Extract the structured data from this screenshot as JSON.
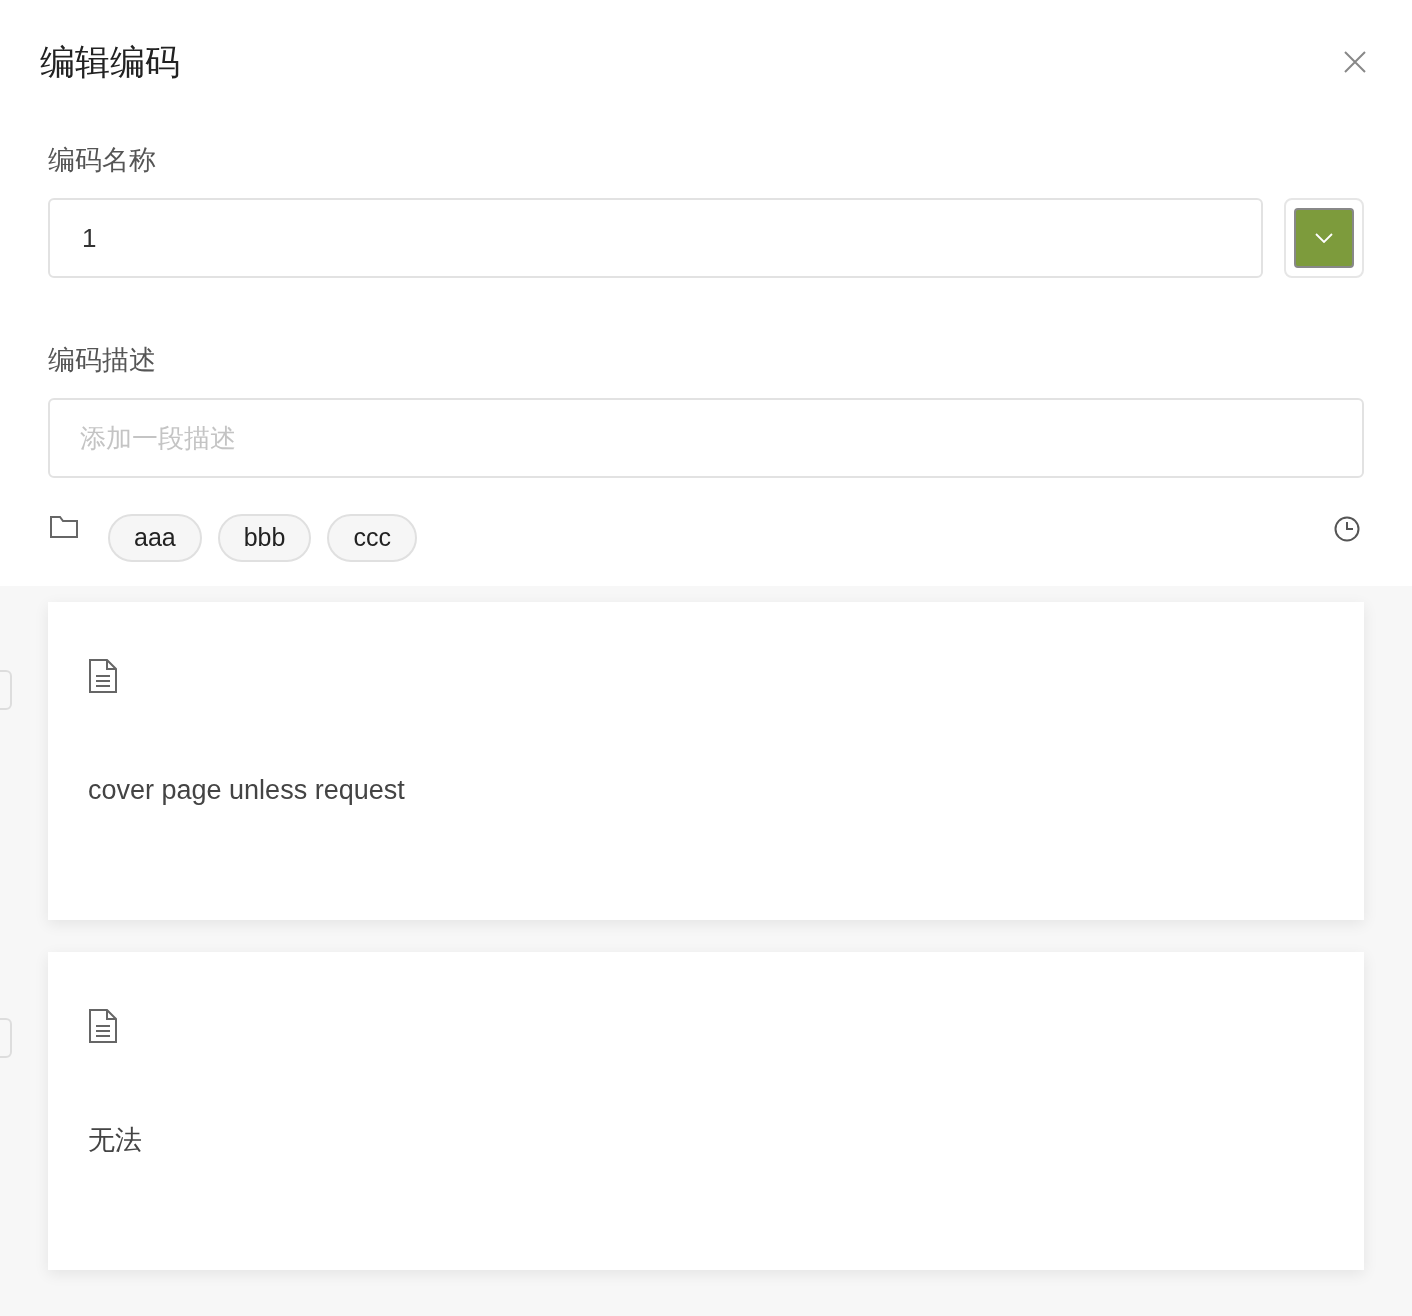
{
  "dialog": {
    "title": "编辑编码"
  },
  "name_field": {
    "label": "编码名称",
    "value": "1",
    "color": "#7d9b3c"
  },
  "description_field": {
    "label": "编码描述",
    "placeholder": "添加一段描述"
  },
  "tags": [
    "aaa",
    "bbb",
    "ccc"
  ],
  "cards": [
    {
      "text": "cover page unless request"
    },
    {
      "text": "无法"
    }
  ]
}
